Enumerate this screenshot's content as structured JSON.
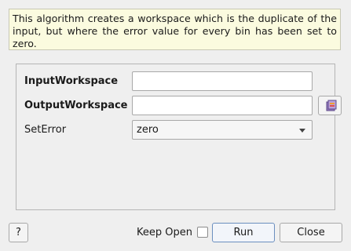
{
  "description": "This algorithm creates a workspace which is the duplicate of the input, but where the error value for every bin has been set to zero.",
  "properties": {
    "input_workspace": {
      "label": "InputWorkspace",
      "value": ""
    },
    "output_workspace": {
      "label": "OutputWorkspace",
      "value": "",
      "browse_icon": "workspace-browse-icon"
    },
    "set_error": {
      "label": "SetError",
      "selected": "zero"
    }
  },
  "footer": {
    "help_label": "?",
    "keep_open_label": "Keep Open",
    "keep_open_checked": false,
    "run_label": "Run",
    "close_label": "Close"
  }
}
